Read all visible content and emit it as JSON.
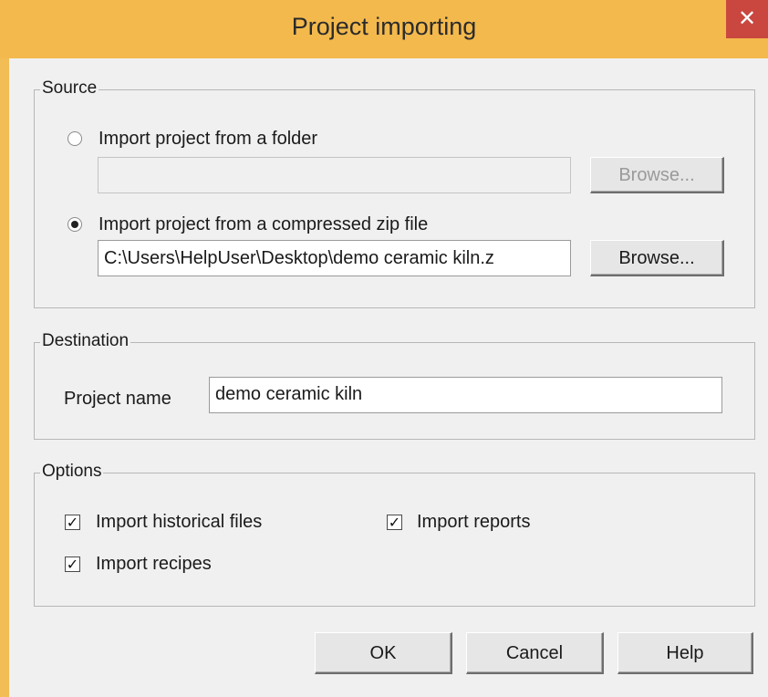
{
  "window": {
    "title": "Project importing",
    "close_glyph": "✕"
  },
  "source": {
    "legend": "Source",
    "folder_option": {
      "label": "Import project from a folder",
      "selected": false,
      "path": "",
      "browse_label": "Browse...",
      "browse_enabled": false
    },
    "zip_option": {
      "label": "Import project from a compressed zip file",
      "selected": true,
      "path": "C:\\Users\\HelpUser\\Desktop\\demo ceramic kiln.z",
      "browse_label": "Browse...",
      "browse_enabled": true
    }
  },
  "destination": {
    "legend": "Destination",
    "project_name_label": "Project name",
    "project_name_value": "demo ceramic kiln"
  },
  "options": {
    "legend": "Options",
    "historical_files": {
      "label": "Import historical files",
      "checked": true
    },
    "reports": {
      "label": "Import reports",
      "checked": true
    },
    "recipes": {
      "label": "Import recipes",
      "checked": true
    },
    "check_glyph": "✓"
  },
  "buttons": {
    "ok": "OK",
    "cancel": "Cancel",
    "help": "Help"
  }
}
